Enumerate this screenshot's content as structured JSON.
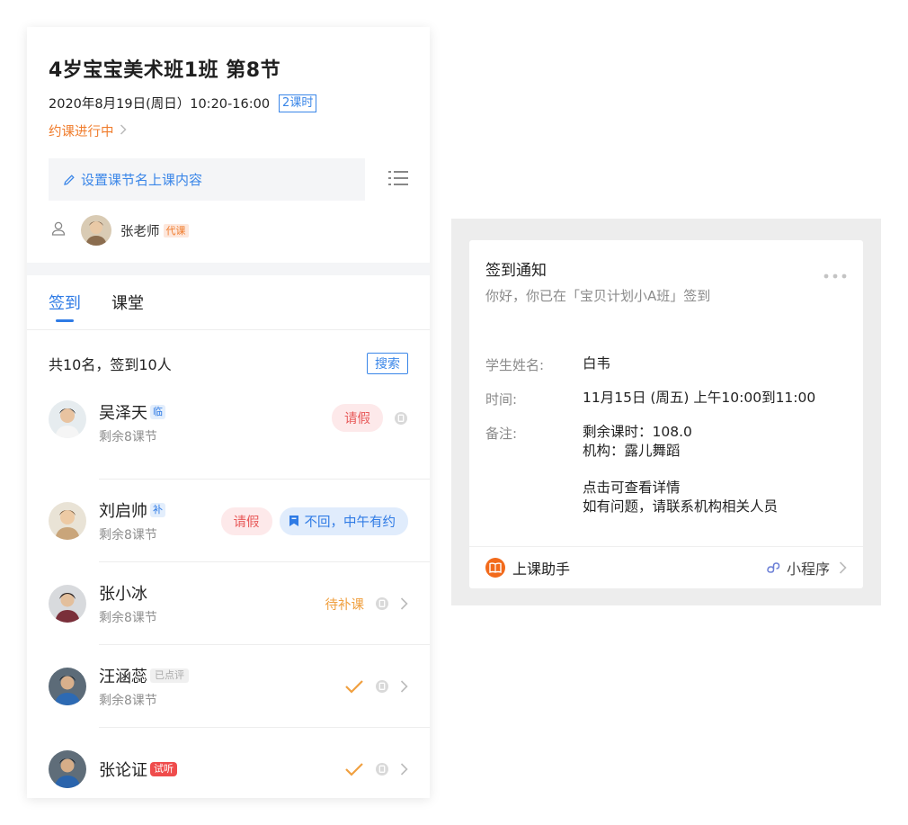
{
  "lesson": {
    "title": "4岁宝宝美术班1班 第8节",
    "datetime": "2020年8月19日(周日）10:20-16:00",
    "hours_badge": "2课时",
    "status": "约课进行中",
    "set_content": "设置课节名上课内容",
    "teacher": {
      "name": "张老师",
      "badge": "代课"
    }
  },
  "tabs": [
    {
      "label": "签到",
      "active": true
    },
    {
      "label": "课堂",
      "active": false
    }
  ],
  "summary": {
    "text": "共10名，签到10人",
    "search_label": "搜索"
  },
  "students": [
    {
      "name": "吴泽天",
      "tag": "临",
      "remaining": "剩余8课节",
      "leave_label": "请假"
    },
    {
      "name": "刘启帅",
      "tag": "补",
      "remaining": "剩余8课节",
      "leave_label": "请假",
      "note": "不回，中午有约"
    },
    {
      "name": "张小冰",
      "remaining": "剩余8课节",
      "status": "待补课"
    },
    {
      "name": "汪涵蕊",
      "tag": "已点评",
      "remaining": "剩余8课节"
    },
    {
      "name": "张论证",
      "tag": "试听"
    }
  ],
  "notice": {
    "title": "签到通知",
    "subtitle": "你好，你已在「宝贝计划小A班」签到",
    "student_label": "学生姓名:",
    "student_value": "白韦",
    "time_label": "时间:",
    "time_value": "11月15日 (周五) 上午10:00到11:00",
    "remark_label": "备注:",
    "remark_lines": [
      "剩余课时：108.0",
      "机构：露儿舞蹈",
      "点击可查看详情",
      "如有问题，请联系机构相关人员"
    ],
    "app_name": "上课助手",
    "mini_program": "小程序"
  },
  "colors": {
    "primary": "#2f7be5",
    "orange": "#f07d2d",
    "leave_red": "#e85a5a",
    "check": "#f0a040",
    "trial_red": "#ef4c4c"
  }
}
